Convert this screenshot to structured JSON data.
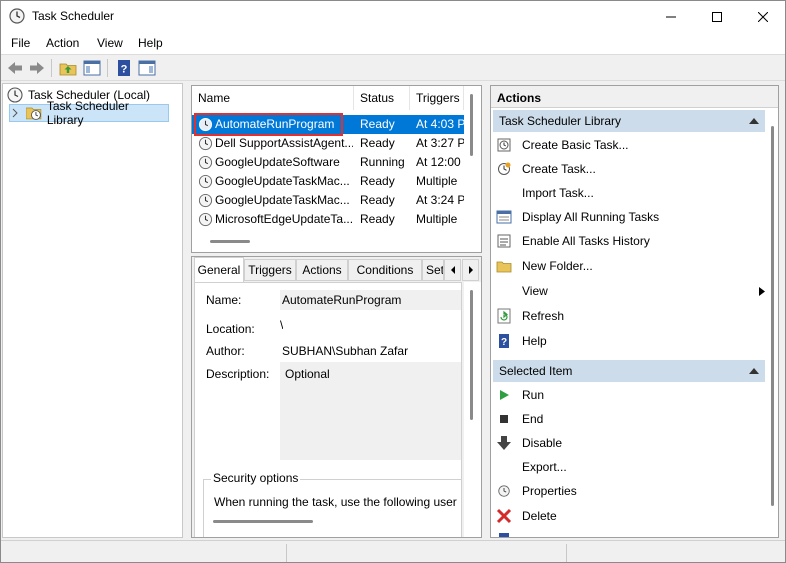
{
  "window": {
    "title": "Task Scheduler"
  },
  "menu": [
    "File",
    "Action",
    "View",
    "Help"
  ],
  "tree": {
    "root": "Task Scheduler (Local)",
    "child": "Task Scheduler Library"
  },
  "tasklist": {
    "headers": [
      "Name",
      "Status",
      "Triggers"
    ],
    "rows": [
      {
        "name": "AutomateRunProgram",
        "status": "Ready",
        "triggers": "At 4:03 P"
      },
      {
        "name": "Dell SupportAssistAgent...",
        "status": "Ready",
        "triggers": "At 3:27 P"
      },
      {
        "name": "GoogleUpdateSoftware",
        "status": "Running",
        "triggers": "At 12:00 ."
      },
      {
        "name": "GoogleUpdateTaskMac...",
        "status": "Ready",
        "triggers": "Multiple"
      },
      {
        "name": "GoogleUpdateTaskMac...",
        "status": "Ready",
        "triggers": "At 3:24 P"
      },
      {
        "name": "MicrosoftEdgeUpdateTa...",
        "status": "Ready",
        "triggers": "Multiple"
      }
    ]
  },
  "details": {
    "tabs": [
      "General",
      "Triggers",
      "Actions",
      "Conditions",
      "Set"
    ],
    "name_label": "Name:",
    "name_value": "AutomateRunProgram",
    "location_label": "Location:",
    "location_value": "\\",
    "author_label": "Author:",
    "author_value": "SUBHAN\\Subhan Zafar",
    "description_label": "Description:",
    "description_value": "Optional",
    "security_title": "Security options",
    "security_text": "When running the task, use the following user"
  },
  "actions": {
    "title": "Actions",
    "group1": "Task Scheduler Library",
    "group1_items": [
      {
        "label": "Create Basic Task...",
        "icon": "create-basic-task-icon"
      },
      {
        "label": "Create Task...",
        "icon": "create-task-icon"
      },
      {
        "label": "Import Task...",
        "icon": "none"
      },
      {
        "label": "Display All Running Tasks",
        "icon": "running-tasks-icon"
      },
      {
        "label": "Enable All Tasks History",
        "icon": "history-icon"
      },
      {
        "label": "New Folder...",
        "icon": "folder-icon"
      },
      {
        "label": "View",
        "icon": "none"
      },
      {
        "label": "Refresh",
        "icon": "refresh-icon"
      },
      {
        "label": "Help",
        "icon": "help-icon"
      }
    ],
    "group2": "Selected Item",
    "group2_items": [
      {
        "label": "Run",
        "icon": "run-icon"
      },
      {
        "label": "End",
        "icon": "end-icon"
      },
      {
        "label": "Disable",
        "icon": "disable-icon"
      },
      {
        "label": "Export...",
        "icon": "none"
      },
      {
        "label": "Properties",
        "icon": "properties-icon"
      },
      {
        "label": "Delete",
        "icon": "delete-icon"
      }
    ]
  },
  "colors": {
    "selection": "#0078d7",
    "group_header": "#cddcea",
    "highlight_box": "#e03030"
  }
}
